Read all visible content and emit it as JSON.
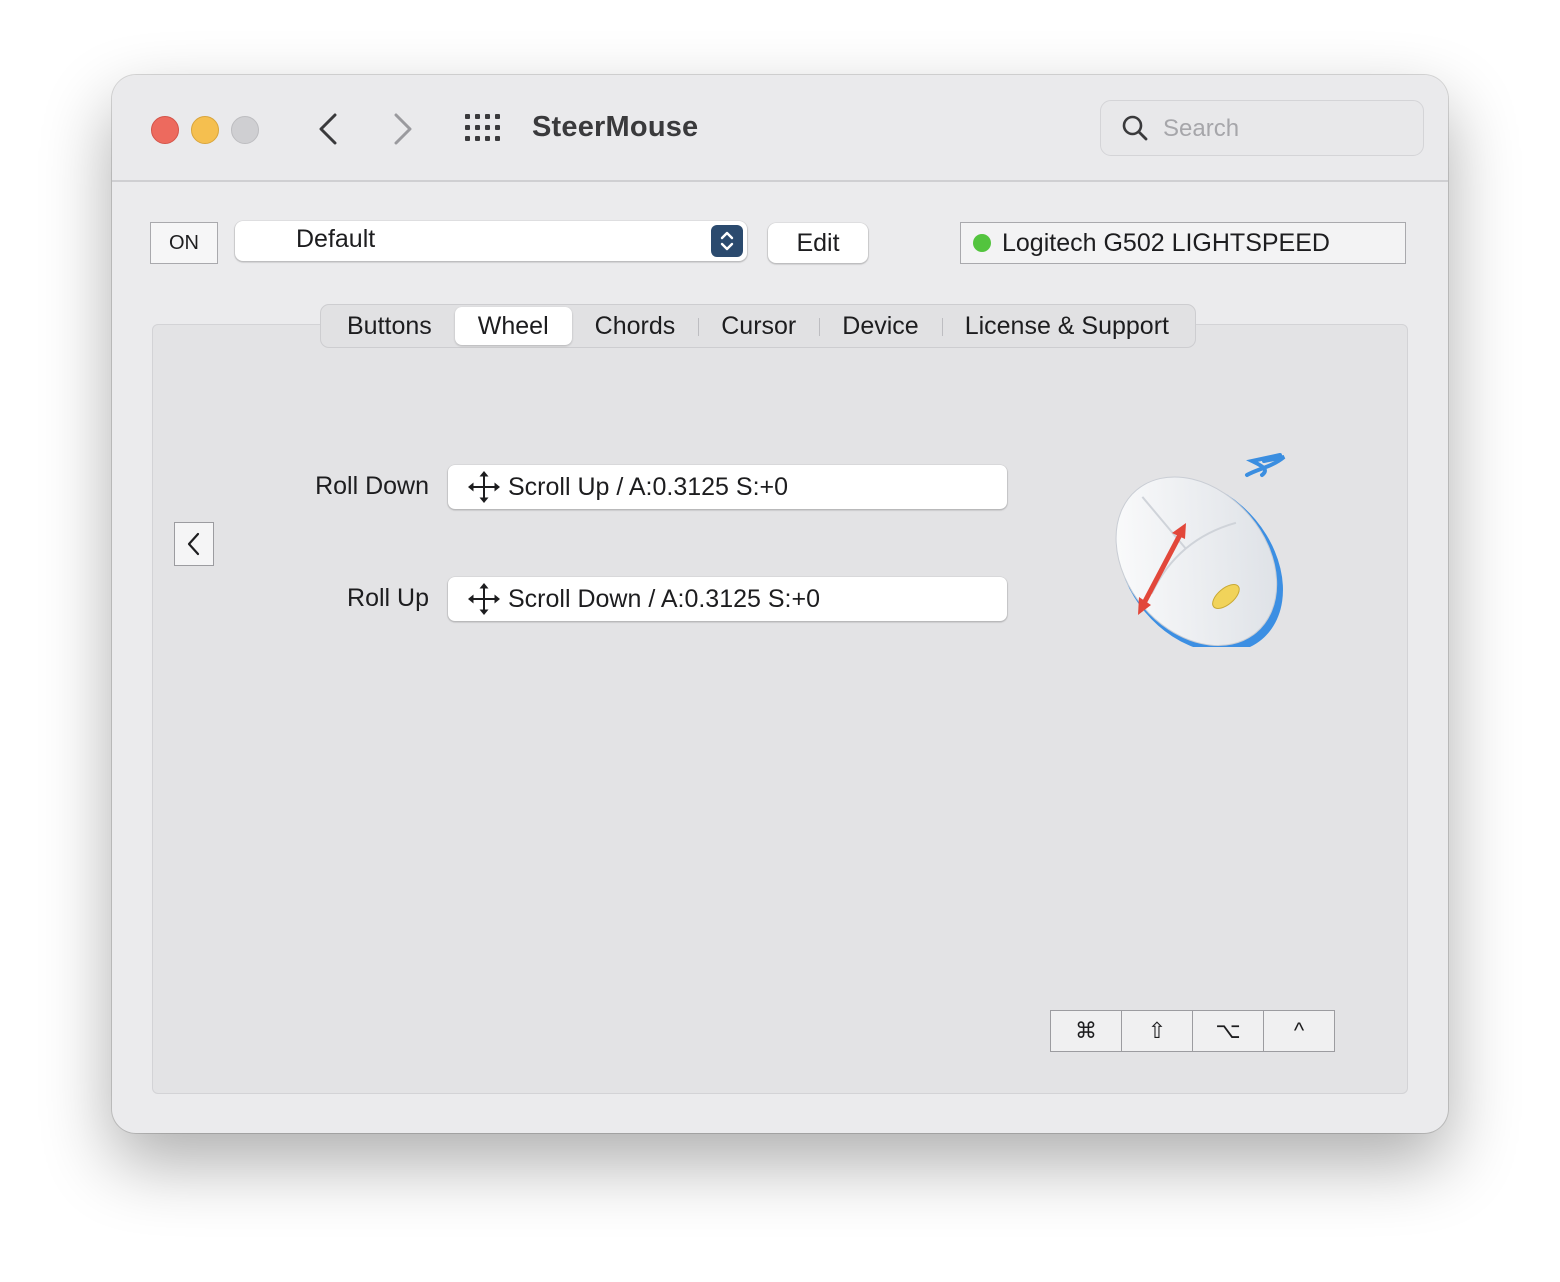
{
  "window": {
    "title": "SteerMouse",
    "search_placeholder": "Search"
  },
  "toolbar": {
    "on_label": "ON",
    "preset_value": "Default",
    "edit_label": "Edit",
    "device_name": "Logitech G502 LIGHTSPEED",
    "device_status_color": "#53c43e"
  },
  "tabs": [
    {
      "label": "Buttons"
    },
    {
      "label": "Wheel",
      "selected": true
    },
    {
      "label": "Chords"
    },
    {
      "label": "Cursor"
    },
    {
      "label": "Device"
    },
    {
      "label": "License & Support"
    }
  ],
  "wheel": {
    "rows": [
      {
        "label": "Roll Down",
        "action": "Scroll Up / A:0.3125 S:+0"
      },
      {
        "label": "Roll Up",
        "action": "Scroll Down / A:0.3125 S:+0"
      }
    ]
  },
  "modifiers": [
    "⌘",
    "⇧",
    "⌥",
    "^"
  ]
}
